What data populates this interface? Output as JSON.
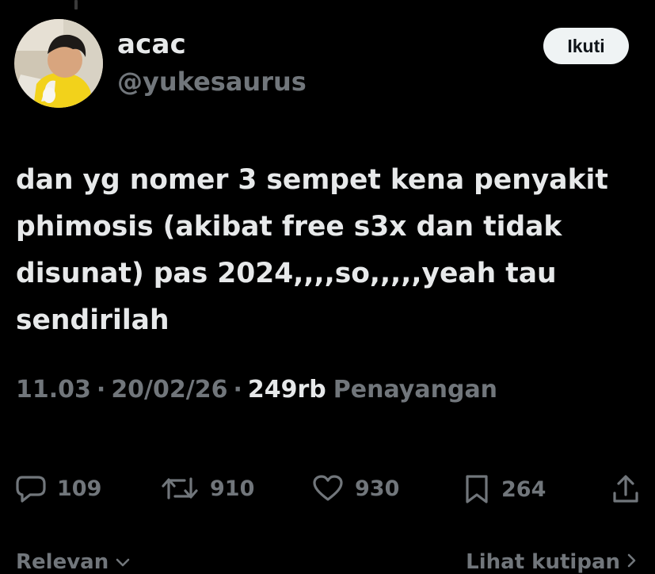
{
  "user": {
    "display_name": "acac",
    "handle": "@yukesaurus",
    "follow_label": "Ikuti",
    "avatar_icon": "profile-photo"
  },
  "tweet": {
    "text": "dan yg nomer 3 sempet kena penyakit\nphimosis (akibat free s3x dan tidak\ndisunat) pas 2024,,,,so,,,,,yeah tau\nsendirilah"
  },
  "meta": {
    "time": "11.03",
    "separator": "·",
    "date": "20/02/26",
    "views_count": "249rb",
    "views_label": "Penayangan"
  },
  "actions": {
    "reply": {
      "icon": "reply-icon",
      "count": "109"
    },
    "repost": {
      "icon": "repost-icon",
      "count": "910"
    },
    "like": {
      "icon": "heart-icon",
      "count": "930"
    },
    "bookmark": {
      "icon": "bookmark-icon",
      "count": "264"
    },
    "share": {
      "icon": "share-icon"
    }
  },
  "footer": {
    "sort_label": "Relevan",
    "quotes_label": "Lihat kutipan"
  },
  "colors": {
    "background": "#000000",
    "primary_text": "#e7e9ea",
    "secondary_text": "#71767b",
    "button_bg": "#eff3f4",
    "button_text": "#0f1419"
  }
}
